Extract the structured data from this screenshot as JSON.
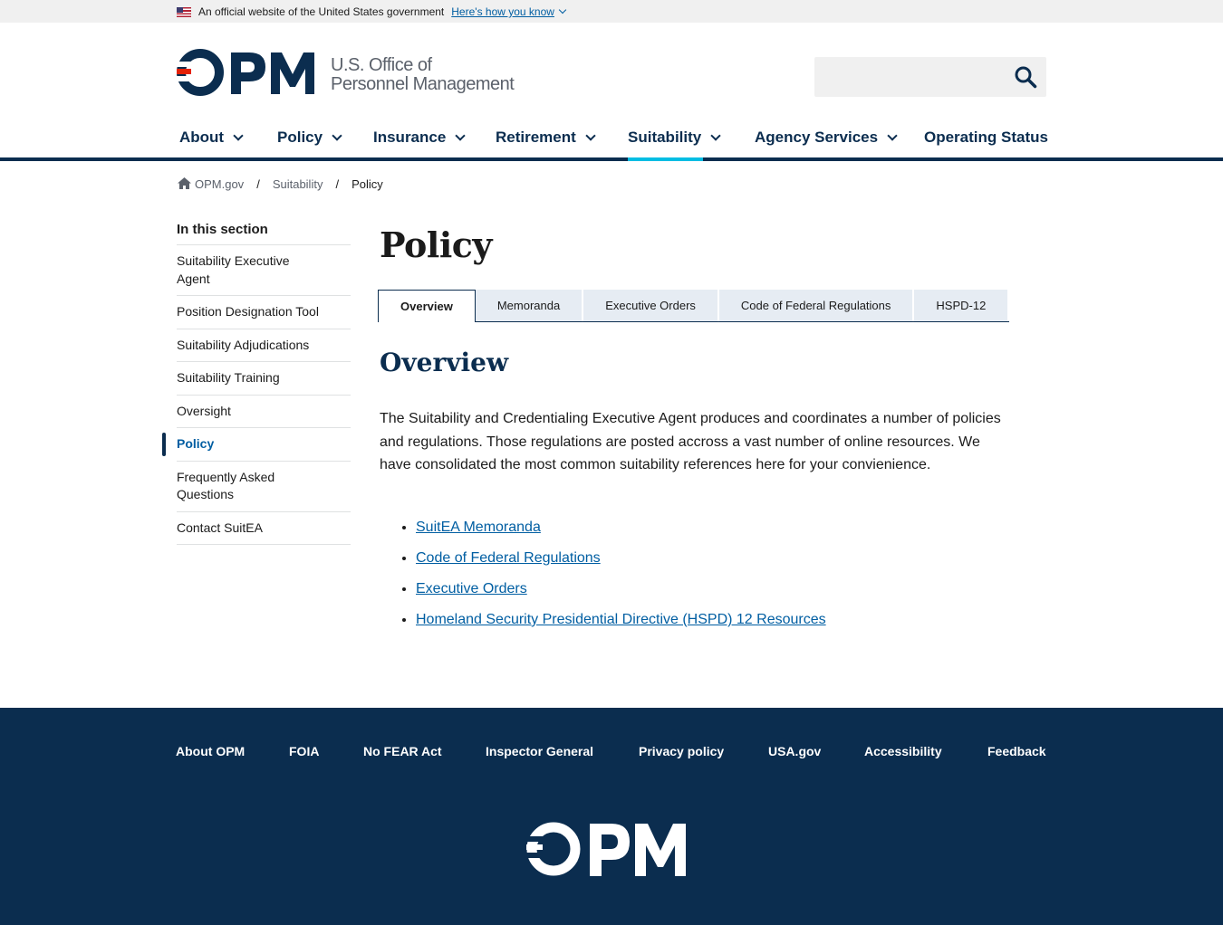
{
  "gov_banner": {
    "text": "An official website of the United States government",
    "link": "Here's how you know"
  },
  "header": {
    "logo_line1": "U.S. Office of",
    "logo_line2": "Personnel Management",
    "search": {
      "value": "",
      "placeholder": ""
    }
  },
  "nav": {
    "items": [
      {
        "label": "About"
      },
      {
        "label": "Policy"
      },
      {
        "label": "Insurance"
      },
      {
        "label": "Retirement"
      },
      {
        "label": "Suitability"
      },
      {
        "label": "Agency Services"
      },
      {
        "label": "Operating Status"
      }
    ],
    "active": "Suitability"
  },
  "breadcrumb": {
    "home": "OPM.gov",
    "sep": "/",
    "level1": "Suitability",
    "current": "Policy"
  },
  "sidenav": {
    "title": "In this section",
    "items": [
      {
        "label": "Suitability Executive Agent"
      },
      {
        "label": "Position Designation Tool"
      },
      {
        "label": "Suitability Adjudications"
      },
      {
        "label": "Suitability Training"
      },
      {
        "label": "Oversight"
      },
      {
        "label": "Policy"
      },
      {
        "label": "Frequently Asked Questions"
      },
      {
        "label": "Contact SuitEA"
      }
    ],
    "active": "Policy"
  },
  "main": {
    "title": "Policy",
    "tabs": [
      {
        "label": "Overview"
      },
      {
        "label": "Memoranda"
      },
      {
        "label": "Executive Orders"
      },
      {
        "label": "Code of Federal Regulations"
      },
      {
        "label": "HSPD-12"
      }
    ],
    "active_tab": "Overview",
    "heading": "Overview",
    "intro": "The Suitability and Credentialing Executive Agent produces and coordinates a number of policies and regulations. Those regulations are posted accross a vast number of online resources. We have consolidated the most common suitability references here for your convienience.",
    "links": [
      {
        "label": "SuitEA Memoranda"
      },
      {
        "label": "Code of Federal Regulations"
      },
      {
        "label": "Executive Orders"
      },
      {
        "label": "Homeland Security Presidential Directive (HSPD) 12 Resources"
      }
    ]
  },
  "footer": {
    "links": [
      {
        "label": "About OPM"
      },
      {
        "label": "FOIA"
      },
      {
        "label": "No FEAR Act"
      },
      {
        "label": "Inspector General"
      },
      {
        "label": "Privacy policy"
      },
      {
        "label": "USA.gov"
      },
      {
        "label": "Accessibility"
      },
      {
        "label": "Feedback"
      }
    ]
  },
  "colors": {
    "navy": "#0b2d4f",
    "accent_cyan": "#00bde3",
    "link_blue": "#005ea2",
    "logo_red": "#e52207"
  },
  "icons": [
    "us-flag-icon",
    "chevron-down-icon",
    "search-icon",
    "home-icon",
    "opm-logo"
  ]
}
